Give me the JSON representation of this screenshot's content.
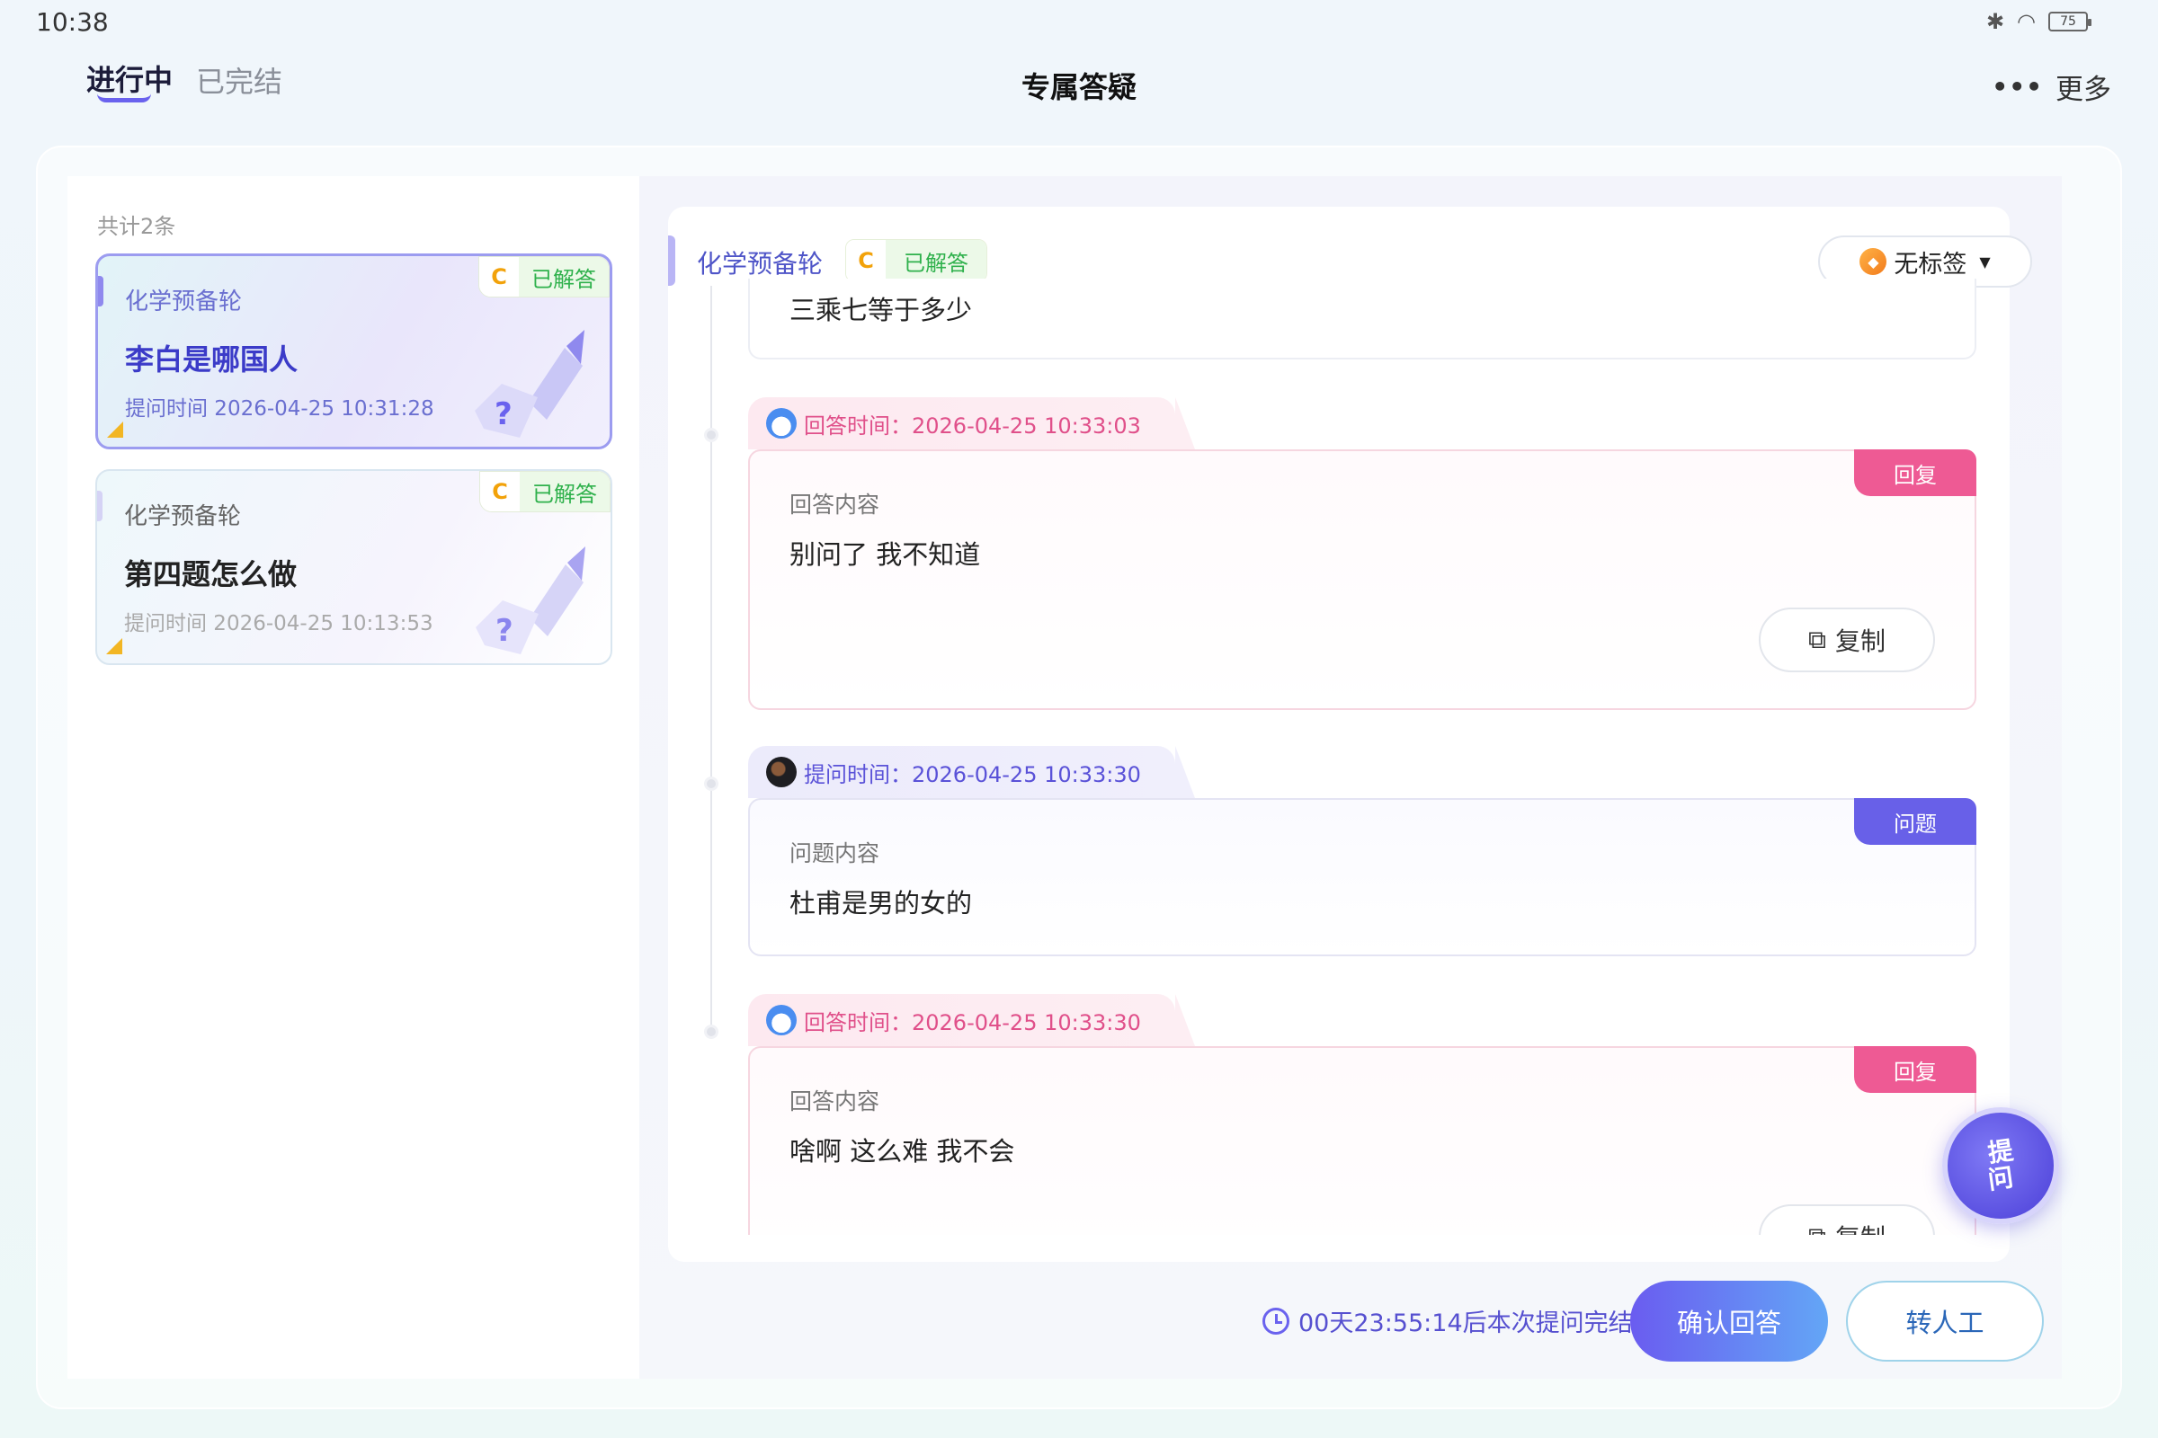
{
  "status_bar": {
    "time": "10:38",
    "battery": "75"
  },
  "header": {
    "tabs": [
      {
        "label": "进行中",
        "active": true
      },
      {
        "label": "已完结",
        "active": false
      }
    ],
    "title": "专属答疑",
    "more_label": "更多"
  },
  "sidebar": {
    "total_label": "共计2条",
    "cards": [
      {
        "subject": "化学预备轮",
        "grade": "C",
        "status": "已解答",
        "title": "李白是哪国人",
        "time": "提问时间 2026-04-25 10:31:28",
        "active": true
      },
      {
        "subject": "化学预备轮",
        "grade": "C",
        "status": "已解答",
        "title": "第四题怎么做",
        "time": "提问时间 2026-04-25 10:13:53",
        "active": false
      }
    ]
  },
  "detail": {
    "subject": "化学预备轮",
    "grade": "C",
    "status": "已解答",
    "tag_button": "无标签",
    "messages": [
      {
        "type": "question",
        "text": "三乘七等于多少"
      },
      {
        "type": "answer",
        "time_label": "回答时间：2026-04-25 10:33:03",
        "ribbon": "回复",
        "content_label": "回答内容",
        "text": "别问了 我不知道",
        "copy_label": "复制"
      },
      {
        "type": "question",
        "time_label": "提问时间：2026-04-25 10:33:30",
        "ribbon": "问题",
        "content_label": "问题内容",
        "text": "杜甫是男的女的"
      },
      {
        "type": "answer",
        "time_label": "回答时间：2026-04-25 10:33:30",
        "ribbon": "回复",
        "content_label": "回答内容",
        "text": "啥啊 这么难 我不会",
        "copy_label": "复制"
      }
    ]
  },
  "footer": {
    "timer": "00天23:55:14后本次提问完结",
    "confirm_label": "确认回答",
    "transfer_label": "转人工"
  },
  "fab": {
    "line1": "提",
    "line2": "问"
  },
  "colors": {
    "accent": "#6a62ee",
    "answer": "#ee5a94",
    "question": "#6860e8",
    "resolved": "#2fb14c",
    "grade": "#f2a20a"
  }
}
